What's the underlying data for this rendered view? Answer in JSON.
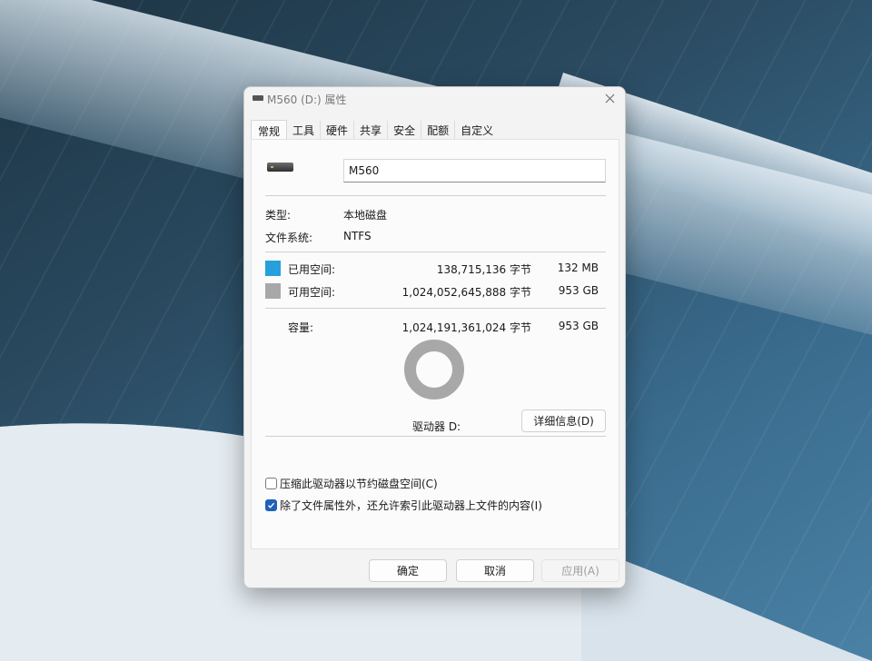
{
  "window": {
    "title": "M560 (D:) 属性",
    "icon": "drive-icon"
  },
  "tabs": [
    "常规",
    "工具",
    "硬件",
    "共享",
    "安全",
    "配额",
    "自定义"
  ],
  "active_tab": "常规",
  "general": {
    "drive_name": "M560",
    "type_label": "类型:",
    "type_value": "本地磁盘",
    "fs_label": "文件系统:",
    "fs_value": "NTFS",
    "used": {
      "label": "已用空间:",
      "bytes": "138,715,136 字节",
      "size": "132 MB",
      "color": "#26a0da"
    },
    "free": {
      "label": "可用空间:",
      "bytes": "1,024,052,645,888 字节",
      "size": "953 GB",
      "color": "#a8a8a8"
    },
    "capacity": {
      "label": "容量:",
      "bytes": "1,024,191,361,024 字节",
      "size": "953 GB"
    },
    "used_fraction": 0.000135,
    "drive_label": "驱动器 D:",
    "details_button": "详细信息(D)",
    "compress_label": "压缩此驱动器以节约磁盘空间(C)",
    "compress_checked": false,
    "index_label": "除了文件属性外，还允许索引此驱动器上文件的内容(I)",
    "index_checked": true
  },
  "buttons": {
    "ok": "确定",
    "cancel": "取消",
    "apply": "应用(A)"
  },
  "colors": {
    "accent": "#1f60b8"
  }
}
